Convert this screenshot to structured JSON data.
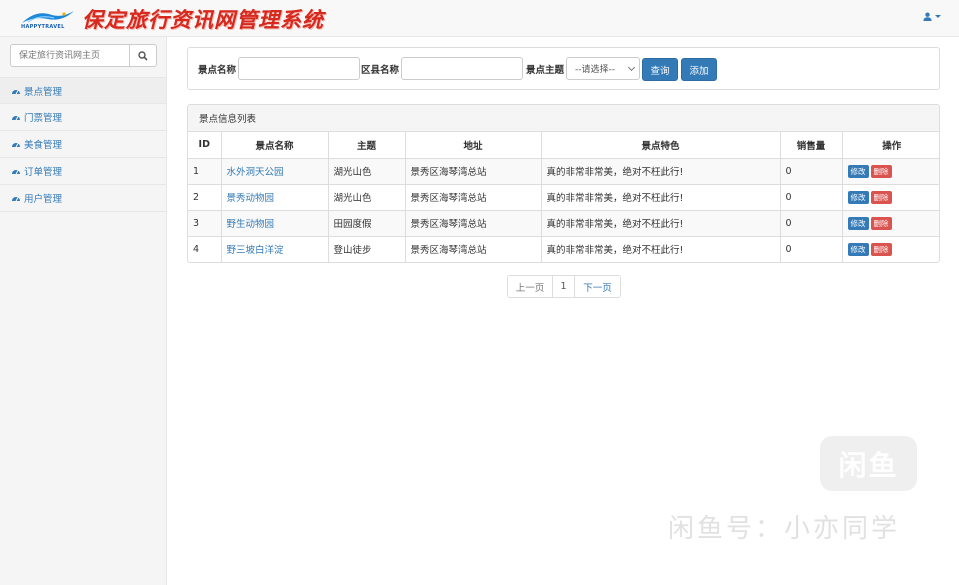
{
  "header": {
    "logo_text": "HAPPYTRAVEL",
    "title": "保定旅行资讯网管理系统",
    "user_icon": "user-icon"
  },
  "sidebar": {
    "search_placeholder": "保定旅行资讯网主页",
    "items": [
      {
        "label": "景点管理",
        "icon": "dashboard-icon"
      },
      {
        "label": "门票管理",
        "icon": "dashboard-icon"
      },
      {
        "label": "美食管理",
        "icon": "dashboard-icon"
      },
      {
        "label": "订单管理",
        "icon": "dashboard-icon"
      },
      {
        "label": "用户管理",
        "icon": "dashboard-icon"
      }
    ]
  },
  "filter": {
    "name_label": "景点名称",
    "district_label": "区县名称",
    "theme_label": "景点主题",
    "theme_selected": "--请选择--",
    "query_button": "查询",
    "add_button": "添加"
  },
  "table": {
    "heading": "景点信息列表",
    "columns": [
      "ID",
      "景点名称",
      "主题",
      "地址",
      "景点特色",
      "销售量",
      "操作"
    ],
    "edit_label": "修改",
    "delete_label": "删除",
    "rows": [
      {
        "id": "1",
        "name": "水外洞天公园",
        "theme": "湖光山色",
        "address": "景秀区海琴湾总站",
        "feature": "真的非常非常美，绝对不枉此行!",
        "sales": "0"
      },
      {
        "id": "2",
        "name": "景秀动物园",
        "theme": "湖光山色",
        "address": "景秀区海琴湾总站",
        "feature": "真的非常非常美，绝对不枉此行!",
        "sales": "0"
      },
      {
        "id": "3",
        "name": "野生动物园",
        "theme": "田园度假",
        "address": "景秀区海琴湾总站",
        "feature": "真的非常非常美，绝对不枉此行!",
        "sales": "0"
      },
      {
        "id": "4",
        "name": "野三坡白洋淀",
        "theme": "登山徒步",
        "address": "景秀区海琴湾总站",
        "feature": "真的非常非常美，绝对不枉此行!",
        "sales": "0"
      }
    ]
  },
  "pagination": {
    "prev": "上一页",
    "current": "1",
    "next": "下一页"
  },
  "watermark": {
    "logo": "闲鱼",
    "text": "闲鱼号：小亦同学"
  },
  "colors": {
    "primary": "#337ab7",
    "danger": "#d9534f",
    "title_red": "#d6281d"
  }
}
